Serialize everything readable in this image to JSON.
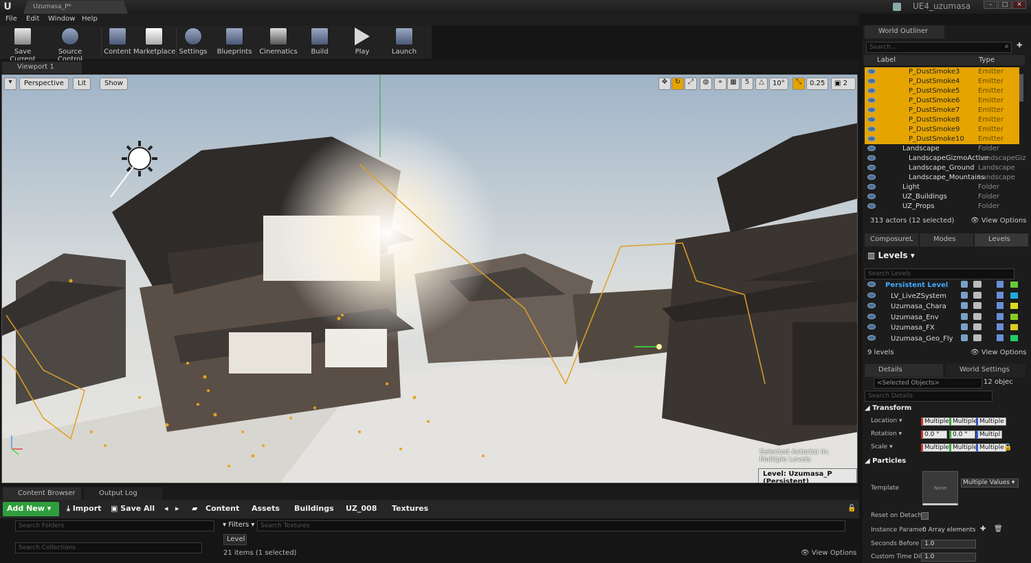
{
  "window": {
    "doc_tab": "Uzumasa_P*",
    "project": "UE4_uzumasa",
    "controls": [
      "–",
      "□",
      "✕"
    ]
  },
  "menu": [
    "File",
    "Edit",
    "Window",
    "Help"
  ],
  "toolbar": {
    "items": [
      "Save Current",
      "Source Control",
      "Content",
      "Marketplace",
      "Settings",
      "Blueprints",
      "Cinematics",
      "Build",
      "Play",
      "Launch"
    ]
  },
  "viewport": {
    "tab": "Viewport 1",
    "buttons": {
      "perspective": "Perspective",
      "lit": "Lit",
      "show": "Show"
    },
    "grid_snap": "5",
    "rot_snap": "10°",
    "scale_snap": "0.25",
    "cam_speed": "2",
    "info_line1": "Selected Actor(s) in:",
    "info_line2": "Multiple Levels",
    "level_label": "Level:  Uzumasa_P (Persistent)"
  },
  "content_browser": {
    "tabs": [
      "Content Browser",
      "Output Log"
    ],
    "add_new": "Add New",
    "import": "Import",
    "save_all": "Save All",
    "breadcrumb": [
      "Content",
      "Assets",
      "Buildings",
      "UZ_008",
      "Textures"
    ],
    "search_folders": "Search Folders",
    "search_collections": "Search Collections",
    "filters": "Filters",
    "search_textures": "Search Textures",
    "filter_chip": "Level",
    "items_count": "21 items (1 selected)",
    "view_options": "View Options"
  },
  "outliner": {
    "tab": "World Outliner",
    "search": "Search...",
    "col_label": "Label",
    "col_type": "Type",
    "rows": [
      {
        "label": "P_DustSmoke3",
        "type": "Emitter",
        "sel": true,
        "indent": 2
      },
      {
        "label": "P_DustSmoke4",
        "type": "Emitter",
        "sel": true,
        "indent": 2
      },
      {
        "label": "P_DustSmoke5",
        "type": "Emitter",
        "sel": true,
        "indent": 2
      },
      {
        "label": "P_DustSmoke6",
        "type": "Emitter",
        "sel": true,
        "indent": 2
      },
      {
        "label": "P_DustSmoke7",
        "type": "Emitter",
        "sel": true,
        "indent": 2
      },
      {
        "label": "P_DustSmoke8",
        "type": "Emitter",
        "sel": true,
        "indent": 2
      },
      {
        "label": "P_DustSmoke9",
        "type": "Emitter",
        "sel": true,
        "indent": 2
      },
      {
        "label": "P_DustSmoke10",
        "type": "Emitter",
        "sel": true,
        "indent": 2
      },
      {
        "label": "Landscape",
        "type": "Folder",
        "sel": false,
        "indent": 1
      },
      {
        "label": "LandscapeGizmoActive",
        "type": "LandscapeGiz",
        "sel": false,
        "indent": 2
      },
      {
        "label": "Landscape_Ground",
        "type": "Landscape",
        "sel": false,
        "indent": 2
      },
      {
        "label": "Landscape_Mountains",
        "type": "Landscape",
        "sel": false,
        "indent": 2
      },
      {
        "label": "Light",
        "type": "Folder",
        "sel": false,
        "indent": 1
      },
      {
        "label": "UZ_Buildings",
        "type": "Folder",
        "sel": false,
        "indent": 1
      },
      {
        "label": "UZ_Props",
        "type": "Folder",
        "sel": false,
        "indent": 1
      }
    ],
    "status": "313 actors (12 selected)",
    "view_options": "View Options"
  },
  "levels": {
    "tabs": [
      "ComposureL",
      "Modes",
      "Levels"
    ],
    "title": "Levels",
    "search": "Search Levels",
    "rows": [
      {
        "name": "Persistent Level",
        "color": "#66cc33",
        "persistent": true
      },
      {
        "name": "LV_LiveZSystem",
        "color": "#22aadd"
      },
      {
        "name": "Uzumasa_Chara",
        "color": "#dddd22"
      },
      {
        "name": "Uzumasa_Env",
        "color": "#88cc22"
      },
      {
        "name": "Uzumasa_FX",
        "color": "#ddcc22"
      },
      {
        "name": "Uzumasa_Geo_Fly",
        "color": "#22cc66"
      }
    ],
    "count": "9 levels",
    "view_options": "View Options"
  },
  "details": {
    "tabs": [
      "Details",
      "World Settings"
    ],
    "selected": "<Selected Objects>",
    "count": "12 objec",
    "search": "Search Details",
    "transform": "Transform",
    "location": "Location",
    "rotation": "Rotation",
    "scale": "Scale",
    "multiple": "Multiple",
    "rot_x": "0.0 °",
    "rot_y": "0.0 °",
    "rot_z": "Multipl",
    "particles": "Particles",
    "template": "Template",
    "template_thumb": "None",
    "template_value": "Multiple Values",
    "reset_on_detach": "Reset on Detach",
    "instance_params": "Instance Paramet",
    "array_elements": "0 Array elements",
    "seconds_before": "Seconds Before I",
    "seconds_value": "1.0",
    "custom_time": "Custom Time Dil",
    "custom_value": "1.0"
  }
}
